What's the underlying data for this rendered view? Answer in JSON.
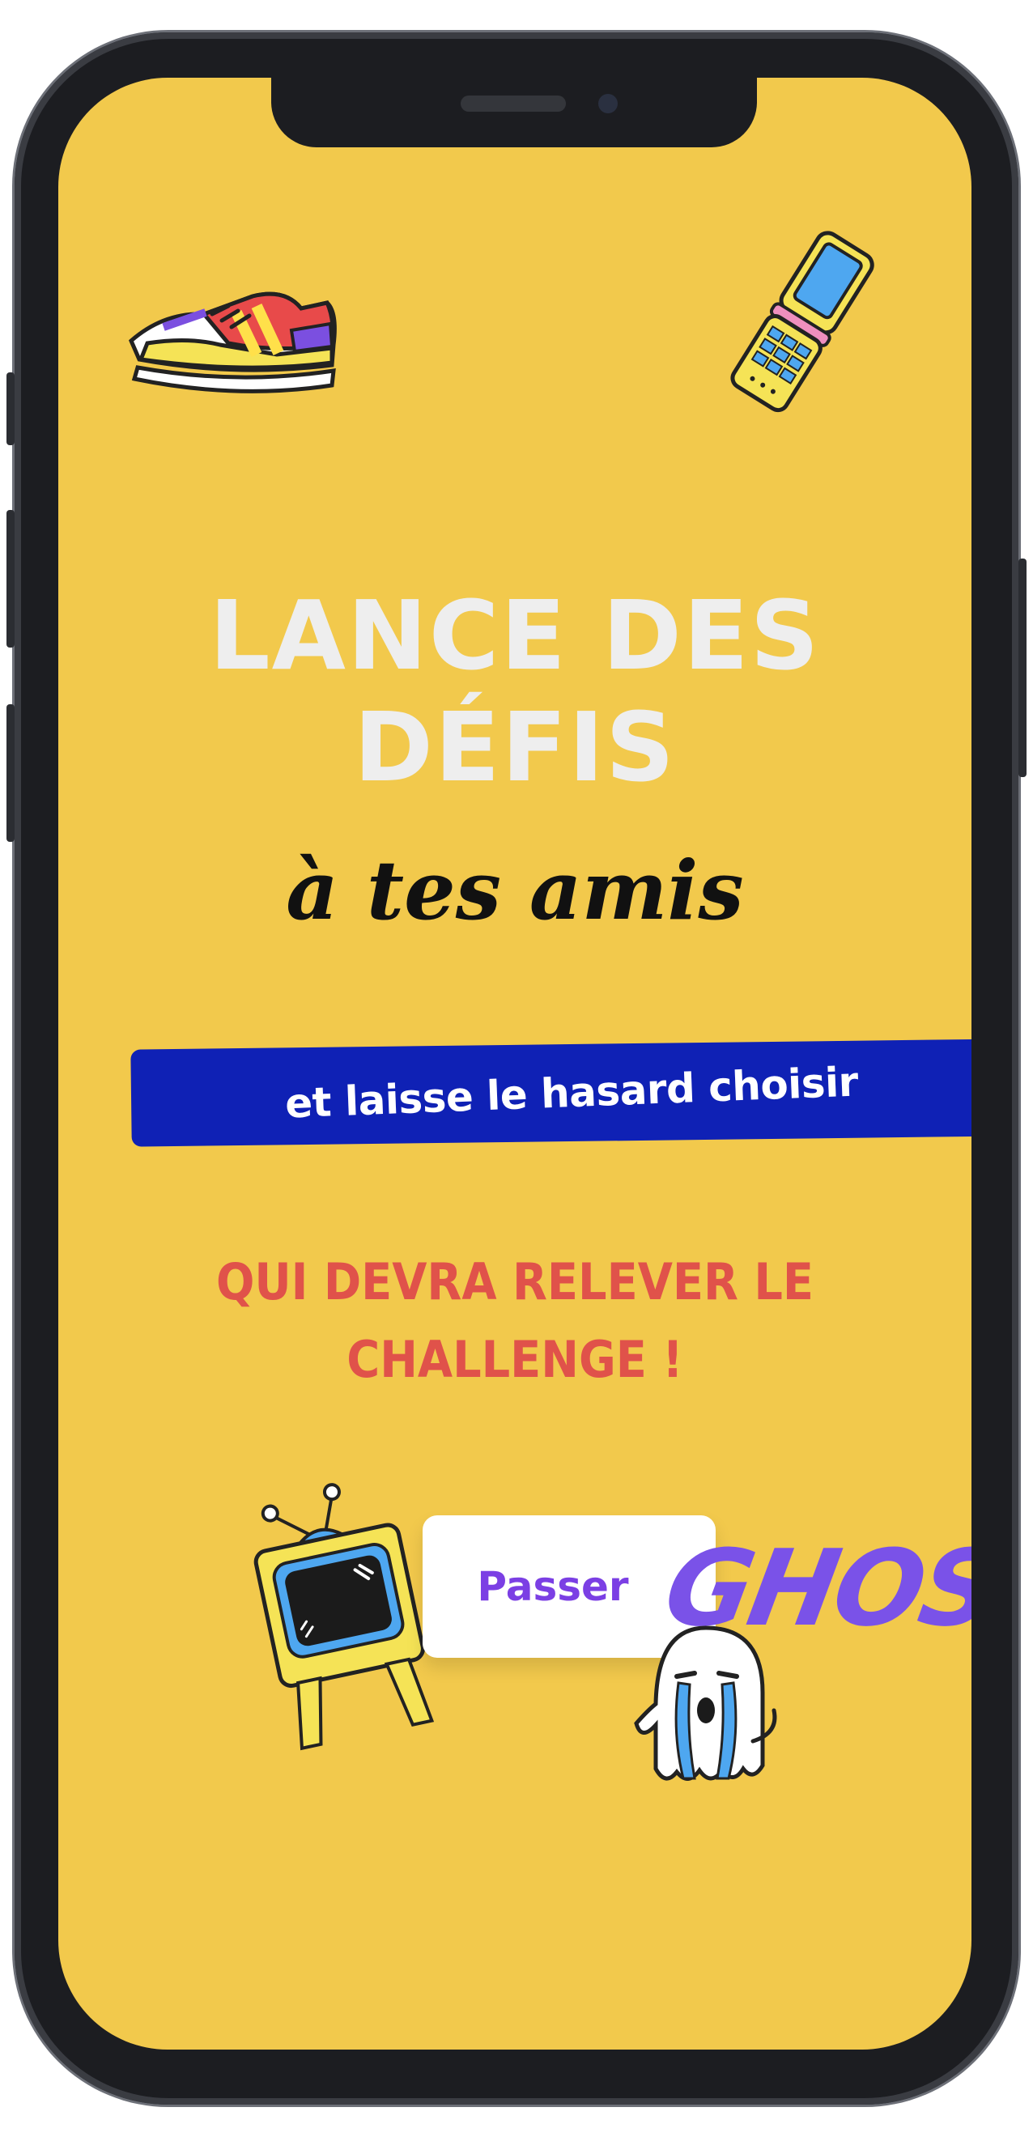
{
  "headline": {
    "line1": "LANCE DES",
    "line2": "DÉFIS"
  },
  "subtitle": "à tes amis",
  "banner": {
    "text": "et laisse le hasard choisir"
  },
  "challenge": {
    "line1": "QUI DEVRA RELEVER LE",
    "line2": "CHALLENGE !"
  },
  "cta": {
    "skip_label": "Passer",
    "ghost_word": "GHOST"
  },
  "stickers": [
    "sneaker-icon",
    "flip-phone-icon",
    "retro-tv-icon",
    "crying-ghost-icon"
  ],
  "colors": {
    "background": "#f2c94c",
    "headline": "#eeeeee",
    "banner": "#0f21b5",
    "challenge": "#e0524a",
    "accent_purple": "#7a52e8"
  }
}
